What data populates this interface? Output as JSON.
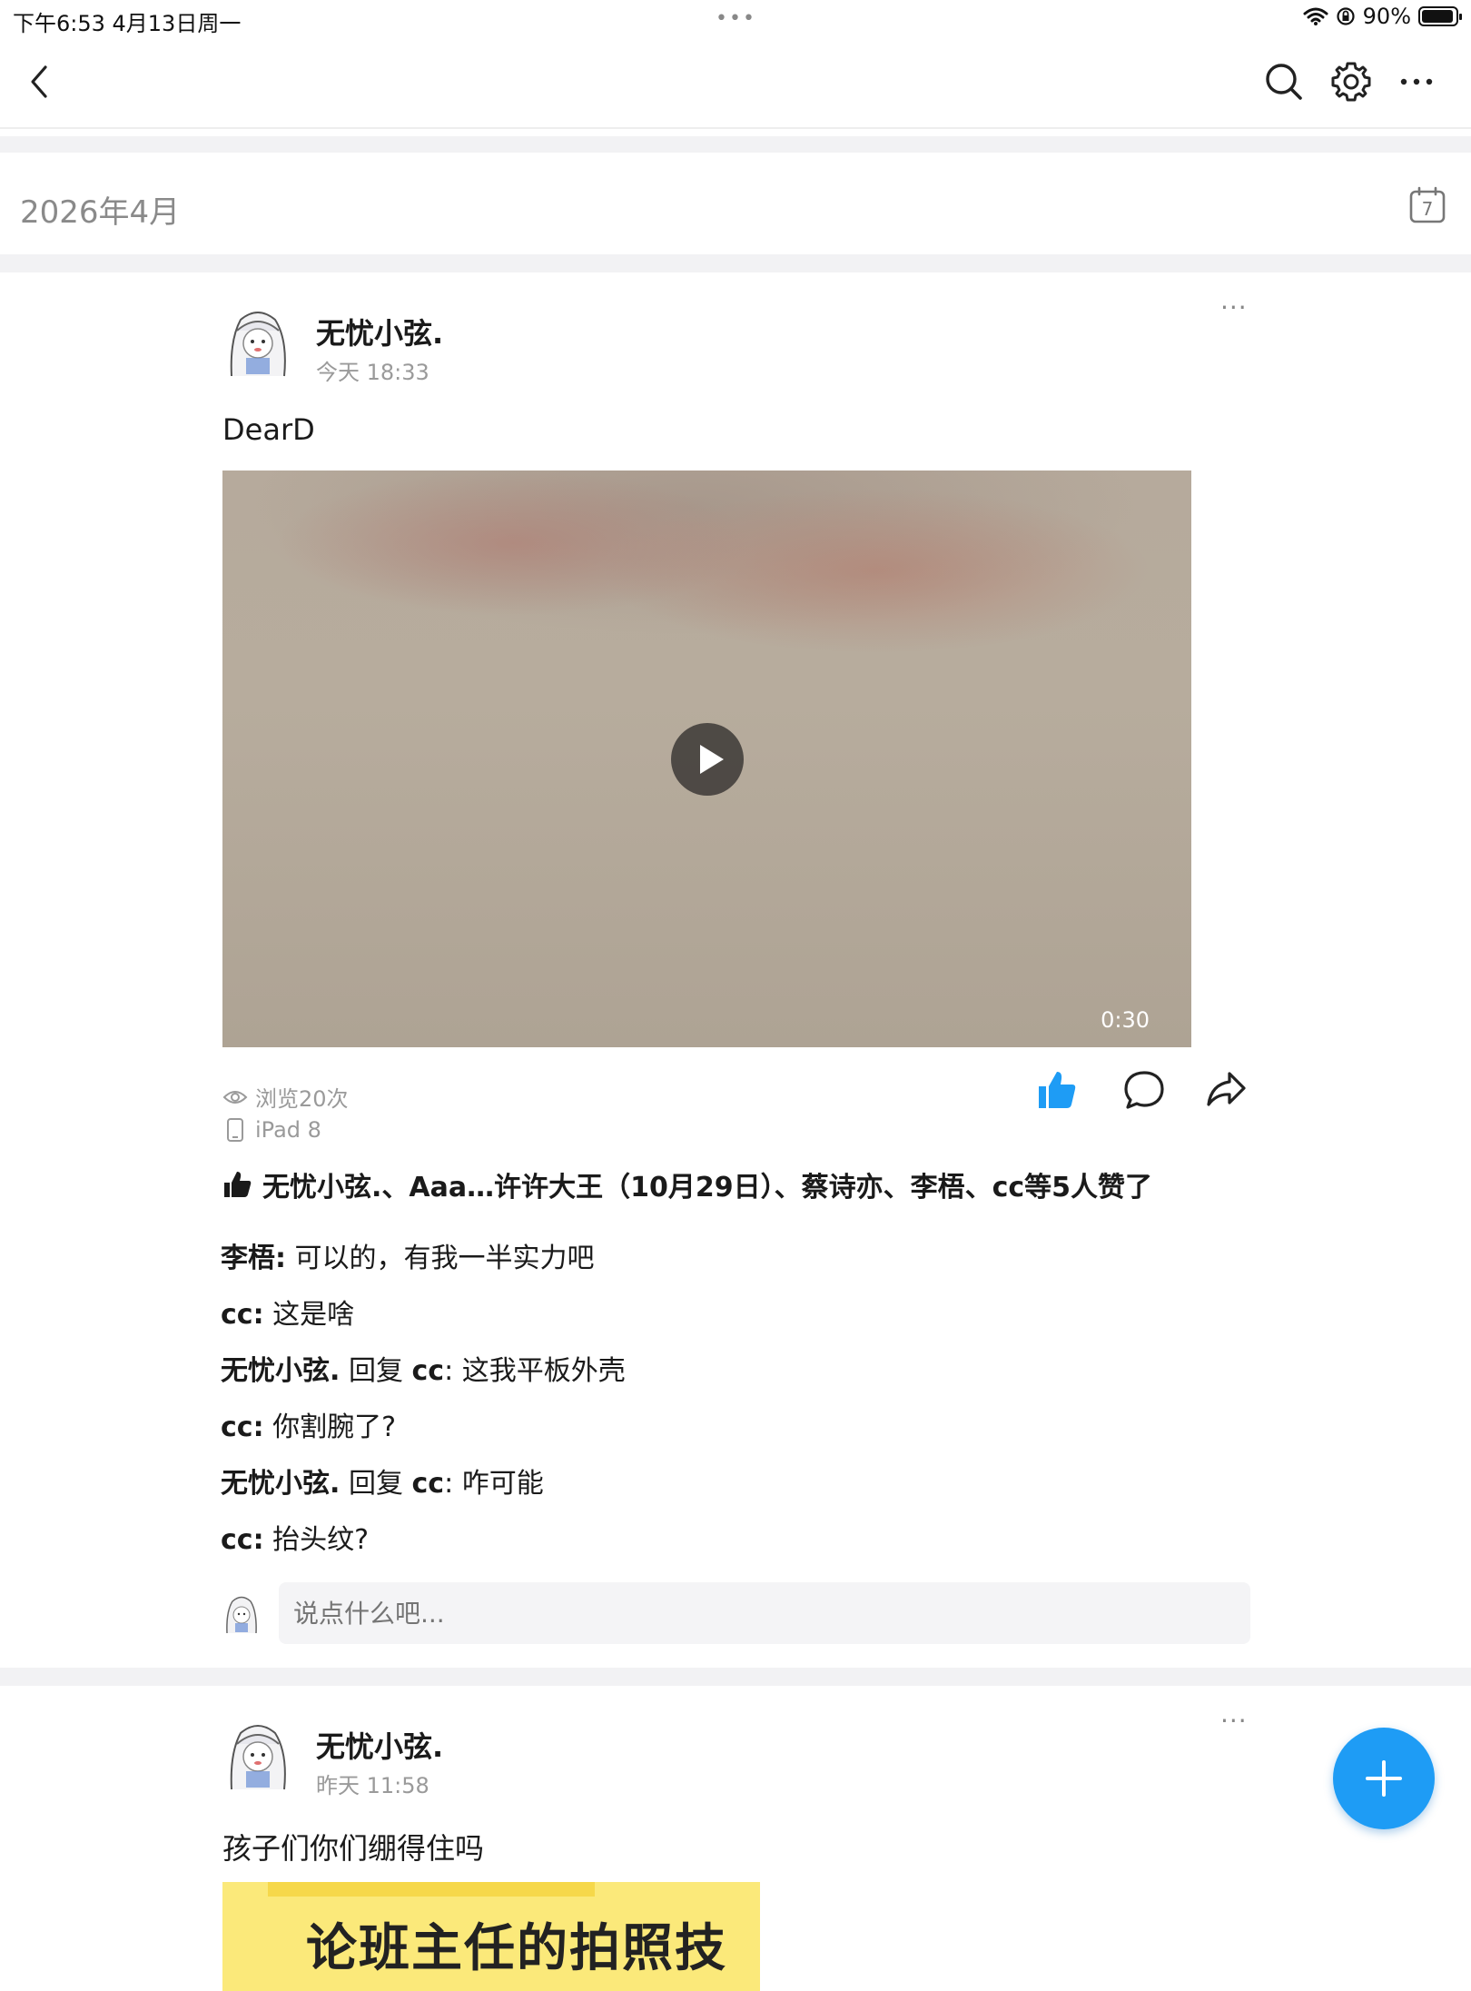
{
  "status_bar": {
    "time_date": "下午6:53   4月13日周一",
    "dots": "•••",
    "battery": "90%"
  },
  "nav": {
    "icons": [
      "back-icon",
      "search-icon",
      "gear-icon",
      "more-icon"
    ]
  },
  "month_header": {
    "label": "2026年4月",
    "calendar_day": "7"
  },
  "posts": [
    {
      "author": "无忧小弦.",
      "time": "今天 18:33",
      "more": "···",
      "text": "DearD",
      "video": {
        "duration": "0:30"
      },
      "views": "浏览20次",
      "device": "iPad 8",
      "likes": "无忧小弦.、Aaa…许许大王（10月29日）、蔡诗亦、李梧、cc等5人赞了",
      "liked": true,
      "comments": [
        {
          "author": "李梧:",
          "reply_to": "",
          "text": "可以的，有我一半实力吧"
        },
        {
          "author": "cc:",
          "reply_to": "",
          "text": "这是啥"
        },
        {
          "author": "无忧小弦.",
          "reply_word": "回复",
          "reply_to": "cc",
          "text": ": 这我平板外壳"
        },
        {
          "author": "cc:",
          "reply_to": "",
          "text": "你割腕了?"
        },
        {
          "author": "无忧小弦.",
          "reply_word": "回复",
          "reply_to": "cc",
          "text": ": 咋可能"
        },
        {
          "author": "cc:",
          "reply_to": "",
          "text": "抬头纹?"
        }
      ],
      "comment_placeholder": "说点什么吧..."
    },
    {
      "author": "无忧小弦.",
      "time": "昨天 11:58",
      "more": "···",
      "text": "孩子们你们绷得住吗",
      "image_title": "论班主任的拍照技术"
    }
  ],
  "colors": {
    "accent": "#1e9cf5",
    "separator": "#f2f2f4",
    "muted_text": "#9a9a9a"
  }
}
